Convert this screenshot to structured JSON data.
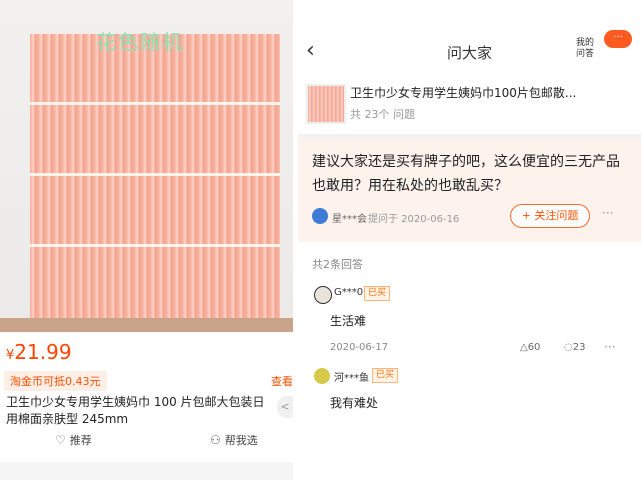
{
  "left": {
    "watermark": "花色随机",
    "price_symbol": "¥",
    "price_value": "21.99",
    "coin_badge": "淘金币可抵0.43元",
    "more_link": "查看",
    "product_title": "卫生巾少女专用学生姨妈巾 100 片包邮大包装日用棉面亲肤型 245mm",
    "share_icon": "share-icon",
    "recommend_label": "推荐",
    "help_choose_label": "帮我选",
    "heart_icon": "♡",
    "people_icon": "⚇"
  },
  "right": {
    "nav": {
      "back_icon": "‹",
      "title": "问大家",
      "my_qa_line1": "我的",
      "my_qa_line2": "问答",
      "badge": "···"
    },
    "product_card": {
      "title": "卫生巾少女专用学生姨妈巾100片包邮散...",
      "count": "共 23个 问题"
    },
    "question": {
      "text": "建议大家还是买有牌子的吧，这么便宜的三无产品也敢用？用在私处的也敢乱买？",
      "asker": "星***会",
      "date": "提问于 2020-06-16",
      "follow_button": "+ 关注问题",
      "more": "···"
    },
    "answers_header": "共2条回答",
    "answers": [
      {
        "name": "G***0",
        "badge": "已买",
        "text": "生活难",
        "date": "2020-06-17",
        "likes": "△60",
        "comments": "◌23",
        "more": "···"
      },
      {
        "name": "河***鱼",
        "badge": "已买",
        "text": "我有难处"
      }
    ]
  },
  "colors": {
    "accent": "#ff5000",
    "question_bg": "#fdf2ec",
    "product_pink": "#f6a895"
  }
}
